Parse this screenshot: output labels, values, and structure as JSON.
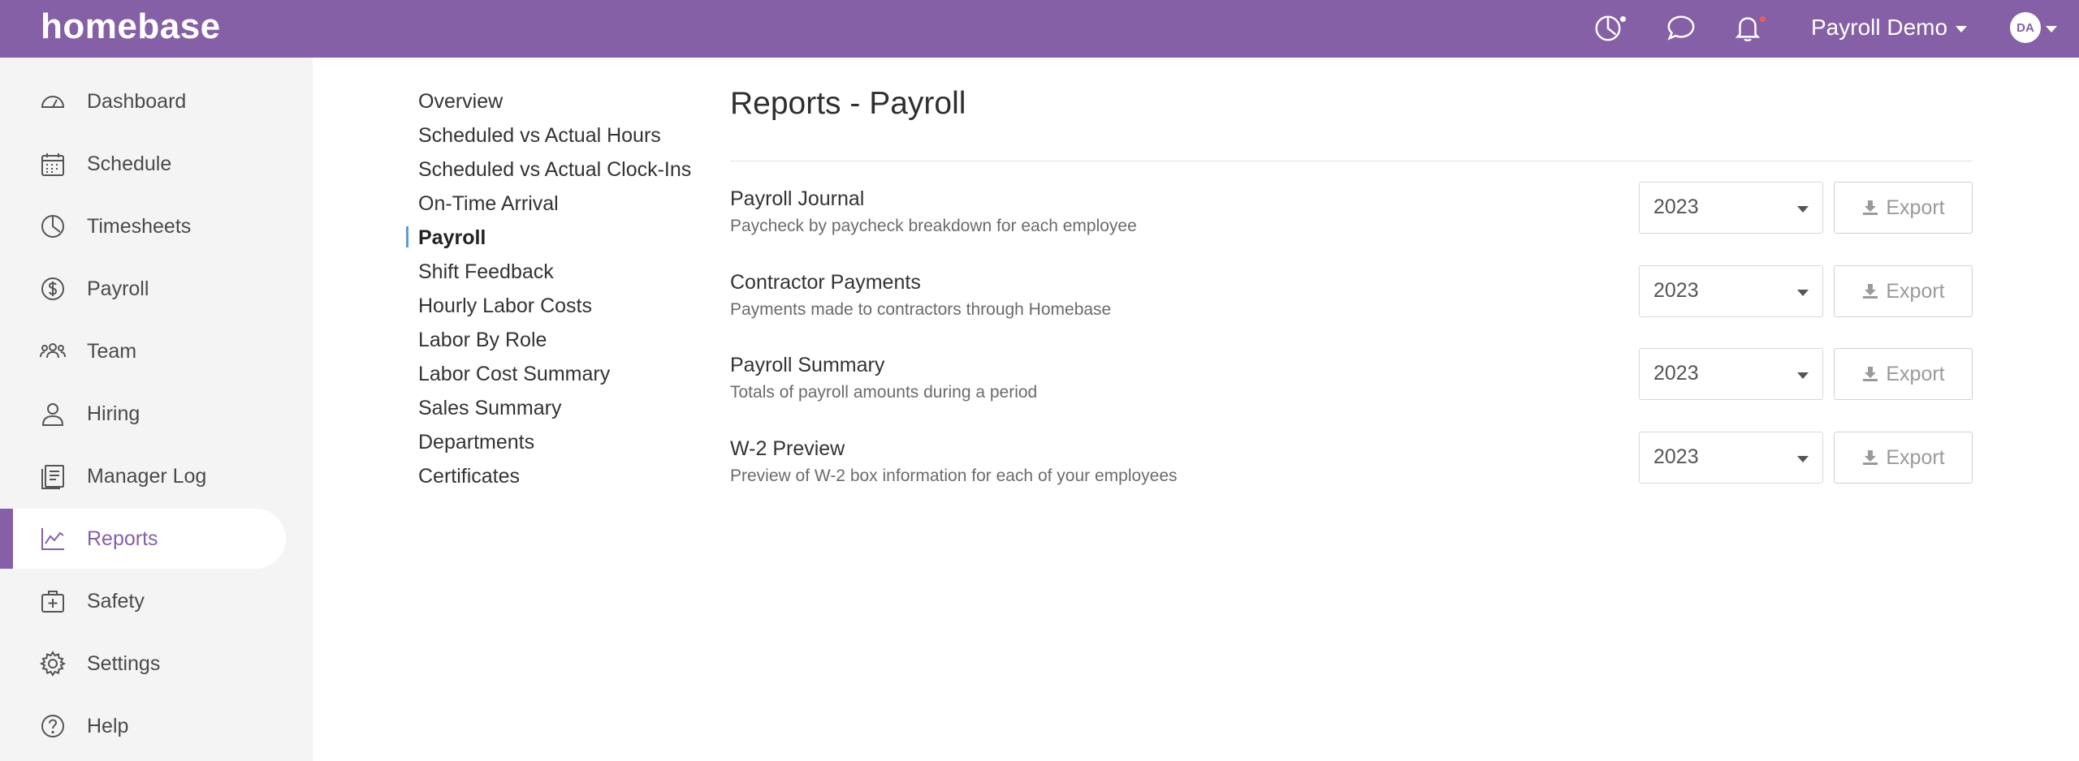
{
  "app": {
    "logo": "homebase"
  },
  "topbar": {
    "icons": [
      "timeclock-icon",
      "chat-icon",
      "bell-icon"
    ],
    "user_label": "Payroll Demo",
    "avatar_initials": "DA",
    "accent_color": "#8560a6"
  },
  "sidebar": {
    "items": [
      {
        "label": "Dashboard",
        "icon": "dashboard-icon",
        "active": false
      },
      {
        "label": "Schedule",
        "icon": "calendar-icon",
        "active": false
      },
      {
        "label": "Timesheets",
        "icon": "clock-icon",
        "active": false
      },
      {
        "label": "Payroll",
        "icon": "dollar-icon",
        "active": false
      },
      {
        "label": "Team",
        "icon": "team-icon",
        "active": false
      },
      {
        "label": "Hiring",
        "icon": "person-icon",
        "active": false
      },
      {
        "label": "Manager Log",
        "icon": "log-book-icon",
        "active": false
      },
      {
        "label": "Reports",
        "icon": "chart-icon",
        "active": true
      },
      {
        "label": "Safety",
        "icon": "first-aid-icon",
        "active": false
      },
      {
        "label": "Settings",
        "icon": "gear-icon",
        "active": false
      },
      {
        "label": "Help",
        "icon": "help-icon",
        "active": false
      }
    ]
  },
  "subnav": {
    "items": [
      {
        "label": "Overview",
        "active": false
      },
      {
        "label": "Scheduled vs Actual Hours",
        "active": false
      },
      {
        "label": "Scheduled vs Actual Clock-Ins",
        "active": false
      },
      {
        "label": "On-Time Arrival",
        "active": false
      },
      {
        "label": "Payroll",
        "active": true
      },
      {
        "label": "Shift Feedback",
        "active": false
      },
      {
        "label": "Hourly Labor Costs",
        "active": false
      },
      {
        "label": "Labor By Role",
        "active": false
      },
      {
        "label": "Labor Cost Summary",
        "active": false
      },
      {
        "label": "Sales Summary",
        "active": false
      },
      {
        "label": "Departments",
        "active": false
      },
      {
        "label": "Certificates",
        "active": false
      }
    ]
  },
  "main": {
    "title": "Reports - Payroll",
    "reports": [
      {
        "title": "Payroll Journal",
        "description": "Paycheck by paycheck breakdown for each employee",
        "year": "2023",
        "export_label": "Export"
      },
      {
        "title": "Contractor Payments",
        "description": "Payments made to contractors through Homebase",
        "year": "2023",
        "export_label": "Export"
      },
      {
        "title": "Payroll Summary",
        "description": "Totals of payroll amounts during a period",
        "year": "2023",
        "export_label": "Export"
      },
      {
        "title": "W-2 Preview",
        "description": "Preview of W-2 box information for each of your employees",
        "year": "2023",
        "export_label": "Export"
      }
    ]
  }
}
